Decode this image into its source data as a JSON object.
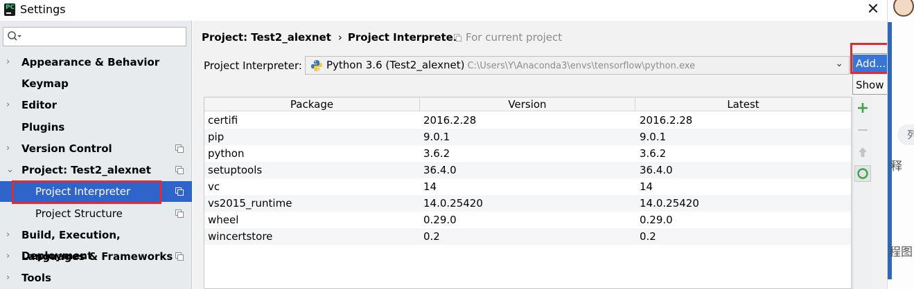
{
  "window": {
    "title": "Settings",
    "app_icon_text": "PC",
    "close_glyph": "✕"
  },
  "sidebar": {
    "search_placeholder": "",
    "items": [
      {
        "label": "Appearance & Behavior",
        "expandable": true,
        "chevron": "›"
      },
      {
        "label": "Keymap",
        "expandable": false,
        "chevron": ""
      },
      {
        "label": "Editor",
        "expandable": true,
        "chevron": "›"
      },
      {
        "label": "Plugins",
        "expandable": false,
        "chevron": ""
      },
      {
        "label": "Version Control",
        "expandable": true,
        "chevron": "›",
        "copy_icon": true
      },
      {
        "label": "Project: Test2_alexnet",
        "expandable": true,
        "expanded": true,
        "chevron": "⌄",
        "copy_icon": true
      },
      {
        "label": "Project Interpreter",
        "sub": true,
        "selected": true,
        "copy_icon": true
      },
      {
        "label": "Project Structure",
        "sub": true,
        "copy_icon": true
      },
      {
        "label": "Build, Execution, Deployment",
        "expandable": true,
        "chevron": "›"
      },
      {
        "label": "Languages & Frameworks",
        "expandable": true,
        "chevron": "›",
        "copy_icon": true
      },
      {
        "label": "Tools",
        "expandable": true,
        "chevron": "›"
      }
    ]
  },
  "main": {
    "breadcrumb": {
      "project": "Project: Test2_alexnet",
      "separator": "›",
      "page": "Project Interpreter"
    },
    "for_current_project": "For current project",
    "interpreter": {
      "label": "Project Interpreter:",
      "name": "Python 3.6 (Test2_alexnet)",
      "path": "C:\\Users\\Y\\Anaconda3\\envs\\tensorflow\\python.exe",
      "caret": "⌄"
    },
    "packages": {
      "columns": [
        "Package",
        "Version",
        "Latest"
      ],
      "rows": [
        [
          "certifi",
          "2016.2.28",
          "2016.2.28"
        ],
        [
          "pip",
          "9.0.1",
          "9.0.1"
        ],
        [
          "python",
          "3.6.2",
          "3.6.2"
        ],
        [
          "setuptools",
          "36.4.0",
          "36.4.0"
        ],
        [
          "vc",
          "14",
          "14"
        ],
        [
          "vs2015_runtime",
          "14.0.25420",
          "14.0.25420"
        ],
        [
          "wheel",
          "0.29.0",
          "0.29.0"
        ],
        [
          "wincertstore",
          "0.2",
          "0.2"
        ]
      ]
    },
    "toolbar": {
      "add_glyph": "+",
      "remove_glyph": "−",
      "upgrade_icon": "arrow-up-icon",
      "refresh_icon": "refresh-icon"
    }
  },
  "popup_menu": {
    "items": [
      {
        "label": "Add...",
        "active": true
      },
      {
        "label": "Show All...",
        "active": false
      }
    ]
  },
  "background_app": {
    "pill_text": "列",
    "text1": "释",
    "text2": "程图"
  },
  "colors": {
    "selection_blue": "#2f65ca",
    "menu_active_blue": "#3875d7",
    "highlight_red": "#e22b30",
    "add_green": "#3fa43f"
  }
}
